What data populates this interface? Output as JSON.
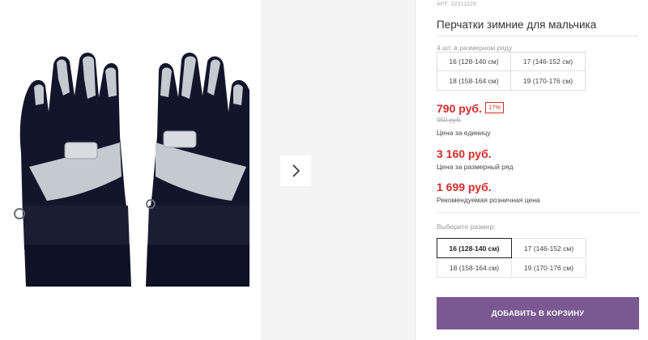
{
  "gallery": {
    "image_label": "Перчатки зимние для мальчика",
    "next_icon": "chevron-right-icon",
    "glove_colors": {
      "body": "#13162b",
      "trim": "#c5c9d0",
      "cuff": "#0f1224"
    }
  },
  "product": {
    "sku": "АРТ. 32311128",
    "title": "Перчатки зимние для мальчика",
    "pack_note": "4 шт. в размерном ряду",
    "pack_sizes": [
      "16 (128-140 см)",
      "17 (146-152 см)",
      "18 (158-164 см)",
      "19 (170-176 см)"
    ]
  },
  "pricing": {
    "unit_price": "790 руб.",
    "discount": "17%",
    "old_price": "950 руб.",
    "unit_label": "Цена за единицу",
    "set_price": "3 160 руб.",
    "set_label": "Цена за размерный ряд",
    "retail_price": "1 699 руб.",
    "retail_label": "Рекомендуемая розничная цена",
    "accent_color": "#d52b2b"
  },
  "size_picker": {
    "label": "Выберите размер:",
    "options": [
      "16 (128-140 см)",
      "17 (146-152 см)",
      "18 (158-164 см)",
      "19 (170-176 см)"
    ],
    "selected": "16 (128-140 см)"
  },
  "cart": {
    "button_label": "ДОБАВИТЬ В КОРЗИНУ",
    "button_color": "#7a5891"
  }
}
